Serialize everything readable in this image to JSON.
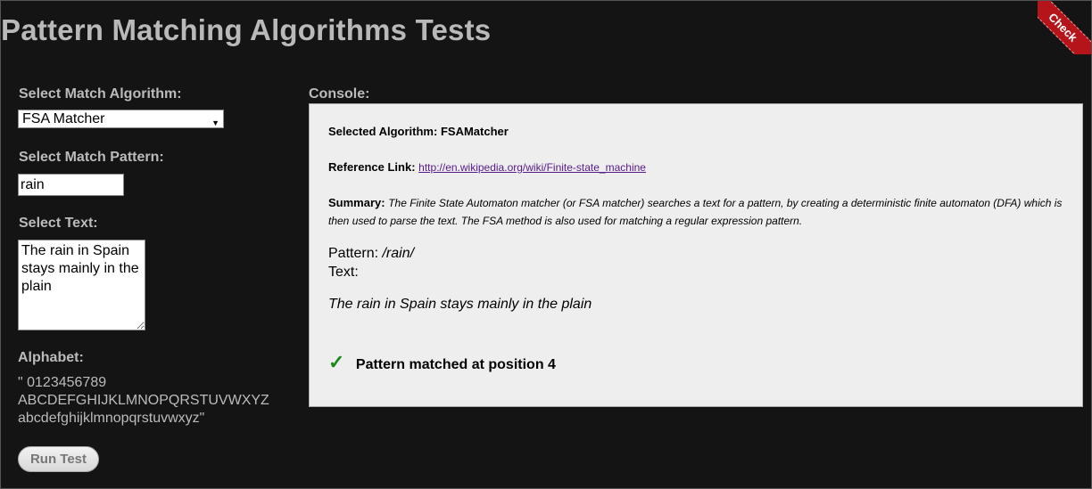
{
  "page": {
    "title": "Pattern Matching Algorithms Tests",
    "ribbon_text": "Check"
  },
  "form": {
    "algorithm_label": "Select Match Algorithm:",
    "algorithm_value": "FSA Matcher",
    "pattern_label": "Select Match Pattern:",
    "pattern_value": "rain",
    "text_label": "Select Text:",
    "text_value": "The rain in Spain stays mainly in the plain",
    "alphabet_label": "Alphabet:",
    "alphabet_value": "\" 0123456789 ABCDEFGHIJKLMNOPQRSTUVWXYZ abcdefghijklmnopqrstuvwxyz\"",
    "run_button": "Run Test"
  },
  "console": {
    "label": "Console:",
    "selected_label": "Selected Algorithm:",
    "selected_value": "FSAMatcher",
    "reference_label": "Reference Link:",
    "reference_url": "http://en.wikipedia.org/wiki/Finite-state_machine",
    "summary_label": "Summary:",
    "summary_text": "The Finite State Automaton matcher (or FSA matcher) searches a text for a pattern, by creating a deterministic finite automaton (DFA) which is then used to parse the text. The FSA method is also used for matching a regular expression pattern.",
    "pattern_label": "Pattern:",
    "pattern_value": "/rain/",
    "text_label": "Text:",
    "text_value": "The rain in Spain stays mainly in the plain",
    "result_icon": "check-icon",
    "result_text": "Pattern matched at position 4",
    "accent_color": "#1a8a1a"
  }
}
